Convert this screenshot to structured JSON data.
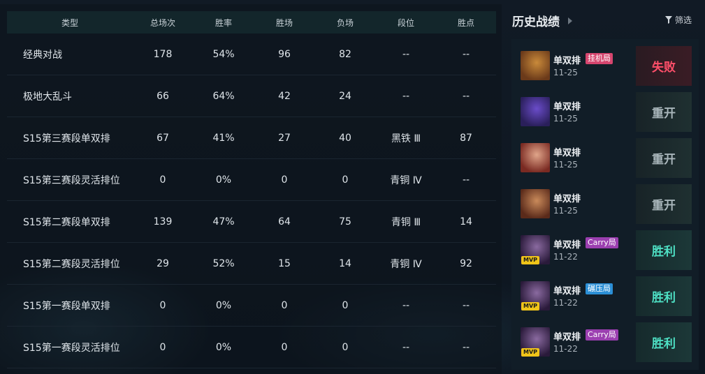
{
  "table": {
    "headers": [
      "类型",
      "总场次",
      "胜率",
      "胜场",
      "负场",
      "段位",
      "胜点"
    ],
    "rows": [
      [
        "经典对战",
        "178",
        "54%",
        "96",
        "82",
        "--",
        "--"
      ],
      [
        "极地大乱斗",
        "66",
        "64%",
        "42",
        "24",
        "--",
        "--"
      ],
      [
        "S15第三赛段单双排",
        "67",
        "41%",
        "27",
        "40",
        "黑铁 Ⅲ",
        "87"
      ],
      [
        "S15第三赛段灵活排位",
        "0",
        "0%",
        "0",
        "0",
        "青铜 Ⅳ",
        "--"
      ],
      [
        "S15第二赛段单双排",
        "139",
        "47%",
        "64",
        "75",
        "青铜 Ⅲ",
        "14"
      ],
      [
        "S15第二赛段灵活排位",
        "29",
        "52%",
        "15",
        "14",
        "青铜 Ⅳ",
        "92"
      ],
      [
        "S15第一赛段单双排",
        "0",
        "0%",
        "0",
        "0",
        "--",
        "--"
      ],
      [
        "S15第一赛段灵活排位",
        "0",
        "0%",
        "0",
        "0",
        "--",
        "--"
      ]
    ]
  },
  "history": {
    "title": "历史战绩",
    "filter_label": "筛选",
    "matches": [
      {
        "mode": "单双排",
        "tag": "挂机局",
        "tag_color": "#d6456e",
        "date": "11-25",
        "result": "失败",
        "result_type": "lose",
        "mvp": false,
        "avatar_colors": [
          "#6b3a1a",
          "#c98a3a"
        ]
      },
      {
        "mode": "单双排",
        "tag": "",
        "tag_color": "",
        "date": "11-25",
        "result": "重开",
        "result_type": "remake",
        "mvp": false,
        "avatar_colors": [
          "#2a1f5a",
          "#6a4cc9"
        ]
      },
      {
        "mode": "单双排",
        "tag": "",
        "tag_color": "",
        "date": "11-25",
        "result": "重开",
        "result_type": "remake",
        "mvp": false,
        "avatar_colors": [
          "#7a2a22",
          "#e0a58a"
        ]
      },
      {
        "mode": "单双排",
        "tag": "",
        "tag_color": "",
        "date": "11-25",
        "result": "重开",
        "result_type": "remake",
        "mvp": false,
        "avatar_colors": [
          "#5a2a1a",
          "#c98a5a"
        ]
      },
      {
        "mode": "单双排",
        "tag": "Carry局",
        "tag_color": "#9b3fb0",
        "date": "11-22",
        "result": "胜利",
        "result_type": "win",
        "mvp": true,
        "avatar_colors": [
          "#2a1a3a",
          "#8a6aa0"
        ]
      },
      {
        "mode": "单双排",
        "tag": "碾压局",
        "tag_color": "#2b8fd6",
        "date": "11-22",
        "result": "胜利",
        "result_type": "win",
        "mvp": true,
        "avatar_colors": [
          "#2a1a3a",
          "#8a6aa0"
        ]
      },
      {
        "mode": "单双排",
        "tag": "Carry局",
        "tag_color": "#9b3fb0",
        "date": "11-22",
        "result": "胜利",
        "result_type": "win",
        "mvp": true,
        "avatar_colors": [
          "#2a1a3a",
          "#8a6aa0"
        ]
      }
    ],
    "mvp_label": "MVP"
  }
}
